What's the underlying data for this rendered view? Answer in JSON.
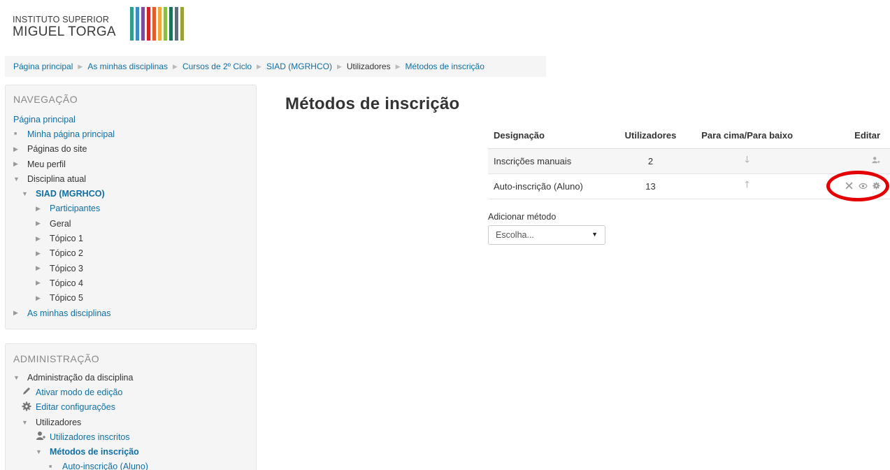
{
  "logo": {
    "line1": "INSTITUTO SUPERIOR",
    "line2": "MIGUEL TORGA",
    "bar_colors": [
      "#2f9e8f",
      "#3a8dc4",
      "#7a4e9b",
      "#d2232a",
      "#e25b2b",
      "#f3a43b",
      "#8bbf43",
      "#1f6f5a",
      "#5b6d7a",
      "#9ba23a"
    ]
  },
  "breadcrumb": [
    {
      "label": "Página principal",
      "link": true
    },
    {
      "label": "As minhas disciplinas",
      "link": true
    },
    {
      "label": "Cursos de 2º Ciclo",
      "link": true
    },
    {
      "label": "SIAD (MGRHCO)",
      "link": true
    },
    {
      "label": "Utilizadores",
      "link": false
    },
    {
      "label": "Métodos de inscrição",
      "link": true
    }
  ],
  "navigation": {
    "title": "NAVEGAÇÃO",
    "home": "Página principal",
    "my_home": "Minha página principal",
    "site_pages": "Páginas do site",
    "my_profile": "Meu perfil",
    "current_course": "Disciplina atual",
    "course_name": "SIAD (MGRHCO)",
    "participants": "Participantes",
    "general": "Geral",
    "topics": [
      "Tópico 1",
      "Tópico 2",
      "Tópico 3",
      "Tópico 4",
      "Tópico 5"
    ],
    "my_courses": "As minhas disciplinas"
  },
  "administration": {
    "title": "ADMINISTRAÇÃO",
    "course_admin": "Administração da disciplina",
    "edit_mode": "Ativar modo de edição",
    "edit_settings": "Editar configurações",
    "users": "Utilizadores",
    "enrolled_users": "Utilizadores inscritos",
    "enrolment_methods": "Métodos de inscrição",
    "self_enrolment": "Auto-inscrição (Aluno)"
  },
  "main": {
    "title": "Métodos de inscrição",
    "table": {
      "headers": [
        "Designação",
        "Utilizadores",
        "Para cima/Para baixo",
        "Editar"
      ],
      "rows": [
        {
          "name": "Inscrições manuais",
          "users": "2",
          "move": "down",
          "edit_icons": [
            "enrol-users-icon"
          ]
        },
        {
          "name": "Auto-inscrição (Aluno)",
          "users": "13",
          "move": "up",
          "edit_icons": [
            "delete-icon",
            "eye-icon",
            "gear-icon"
          ]
        }
      ]
    },
    "add_method_label": "Adicionar método",
    "add_method_select": "Escolha..."
  },
  "colors": {
    "link": "#0f6fa5",
    "highlight": "#e40000"
  }
}
